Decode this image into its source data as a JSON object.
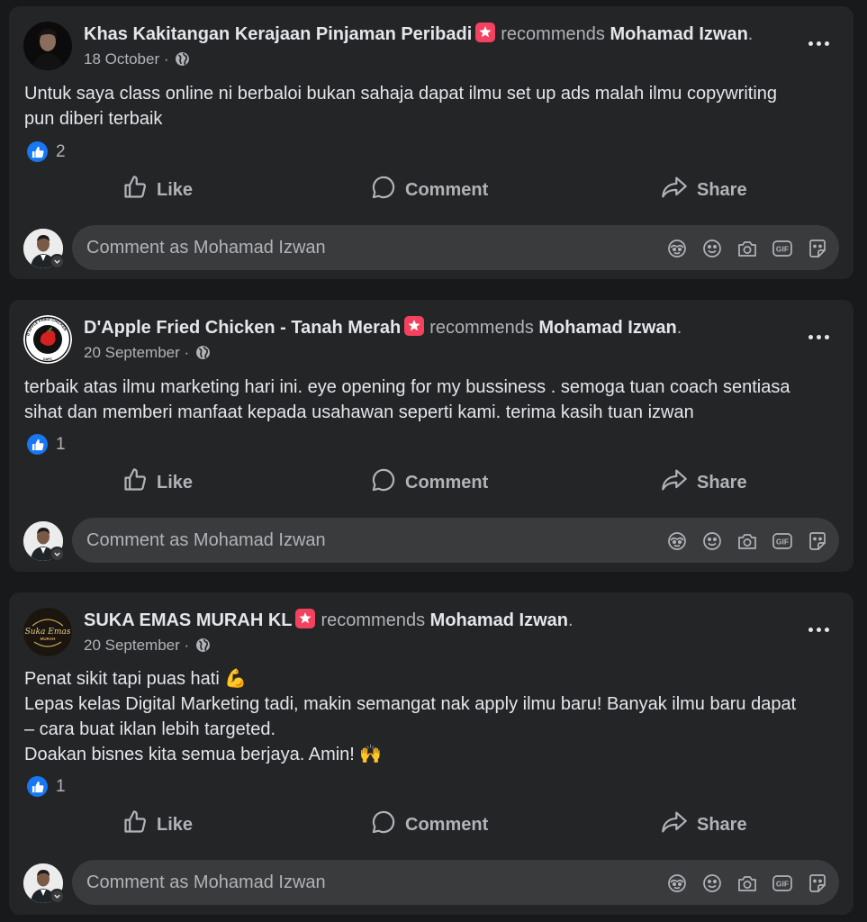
{
  "posts": [
    {
      "author": "Khas Kakitangan Kerajaan Pinjaman Peribadi",
      "recommends": "recommends",
      "target": "Mohamad Izwan",
      "date": "18 October",
      "text_lines": [
        "Untuk saya class online ni berbaloi bukan sahaja dapat ilmu set up ads malah ilmu copywriting",
        "pun diberi terbaik"
      ],
      "likes": "2"
    },
    {
      "author": "D'Apple Fried Chicken - Tanah Merah",
      "recommends": "recommends",
      "target": "Mohamad Izwan",
      "date": "20 September",
      "text_lines": [
        "terbaik atas ilmu marketing hari ini. eye opening for my bussiness . semoga tuan coach sentiasa",
        "sihat dan memberi manfaat kepada usahawan seperti kami. terima kasih tuan izwan"
      ],
      "likes": "1"
    },
    {
      "author": "SUKA EMAS MURAH KL",
      "recommends": "recommends",
      "target": "Mohamad Izwan",
      "date": "20 September",
      "text_lines": [
        "Penat sikit tapi puas hati 💪",
        "Lepas kelas Digital Marketing tadi, makin semangat nak apply ilmu baru! Banyak ilmu baru dapat",
        "– cara buat iklan lebih targeted.",
        "Doakan bisnes kita semua berjaya. Amin! 🙌"
      ],
      "likes": "1"
    }
  ],
  "actions": {
    "like": "Like",
    "comment": "Comment",
    "share": "Share"
  },
  "comment_placeholder": "Comment as Mohamad Izwan",
  "logos": {
    "dapple_ring": "D'APPLE FRIED CHICKEN",
    "dapple_sub": "DAFC",
    "suka_line1": "Suka Emas",
    "suka_line2": "MURAH"
  },
  "colors": {
    "background": "#18191a",
    "card": "#242526",
    "input": "#3a3b3c",
    "like_blue": "#1877f2",
    "recommend_red": "#f3425f",
    "text_primary": "#e4e6eb",
    "text_secondary": "#b0b3b8"
  },
  "icons": [
    "recommend-star-icon",
    "globe-icon",
    "more-icon",
    "like-reaction-icon",
    "like-thumb-icon",
    "comment-bubble-icon",
    "share-arrow-icon",
    "avatar-sticker-icon",
    "emoji-icon",
    "camera-icon",
    "gif-icon",
    "sticker-icon",
    "chevron-down-icon"
  ]
}
